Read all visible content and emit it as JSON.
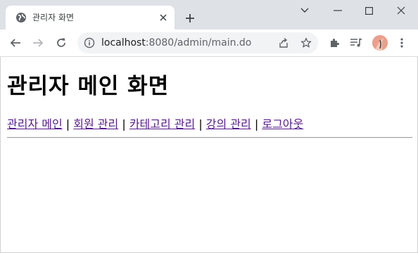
{
  "browser": {
    "tab": {
      "title": "관리자 화면",
      "favicon": "globe-icon"
    },
    "new_tab_icon": "plus-icon",
    "window_controls": [
      "chevron-down-icon",
      "minimize-icon",
      "maximize-icon",
      "close-icon"
    ],
    "address_bar": {
      "host": "localhost",
      "rest": ":8080/admin/main.do",
      "info_icon": "info-icon"
    },
    "toolbar_icons": [
      "back-icon",
      "forward-icon",
      "reload-icon",
      "share-icon",
      "star-icon",
      "extensions-icon",
      "media-queue-icon",
      "profile-avatar",
      "more-menu-icon"
    ]
  },
  "page": {
    "title": "관리자 메인 화면",
    "nav": [
      {
        "label": "관리자 메인"
      },
      {
        "label": "회원 관리"
      },
      {
        "label": "카테고리 관리"
      },
      {
        "label": "강의 관리"
      },
      {
        "label": "로그아웃"
      }
    ],
    "separator": "|"
  },
  "colors": {
    "titlebar": "#dee1e6",
    "visited_link": "#551a8b",
    "link": "#0000ee"
  }
}
